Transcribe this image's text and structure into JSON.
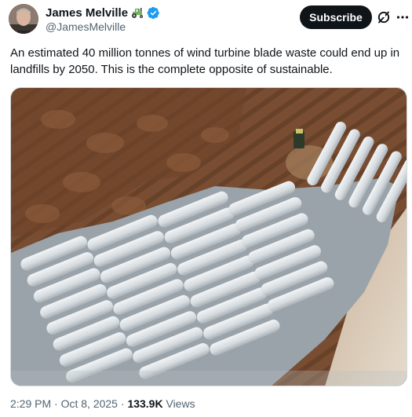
{
  "author": {
    "display_name": "James Melville",
    "name_emoji": "tractor-emoji",
    "verified": "verified-badge-icon",
    "handle": "@JamesMelville"
  },
  "actions": {
    "subscribe_label": "Subscribe",
    "grok_icon": "grok-icon",
    "more_icon": "more-options-icon"
  },
  "tweet": {
    "text": "An estimated 40 million tonnes of wind turbine blade waste could end up in landfills by 2050. This is the complete opposite of sustainable."
  },
  "media": {
    "type": "photo",
    "alt": "",
    "icon": "aerial-photo-of-wind-turbine-blades-in-landfill"
  },
  "meta": {
    "time": "2:29 PM",
    "sep1": "·",
    "date": "Oct 8, 2025",
    "sep2": "·",
    "views_count": "133.9K",
    "views_label": "Views"
  },
  "colors": {
    "text": "#0f1419",
    "secondary": "#536471",
    "verified": "#1d9bf0",
    "subscribe_bg": "#0f1419",
    "border": "#cfd9de"
  }
}
